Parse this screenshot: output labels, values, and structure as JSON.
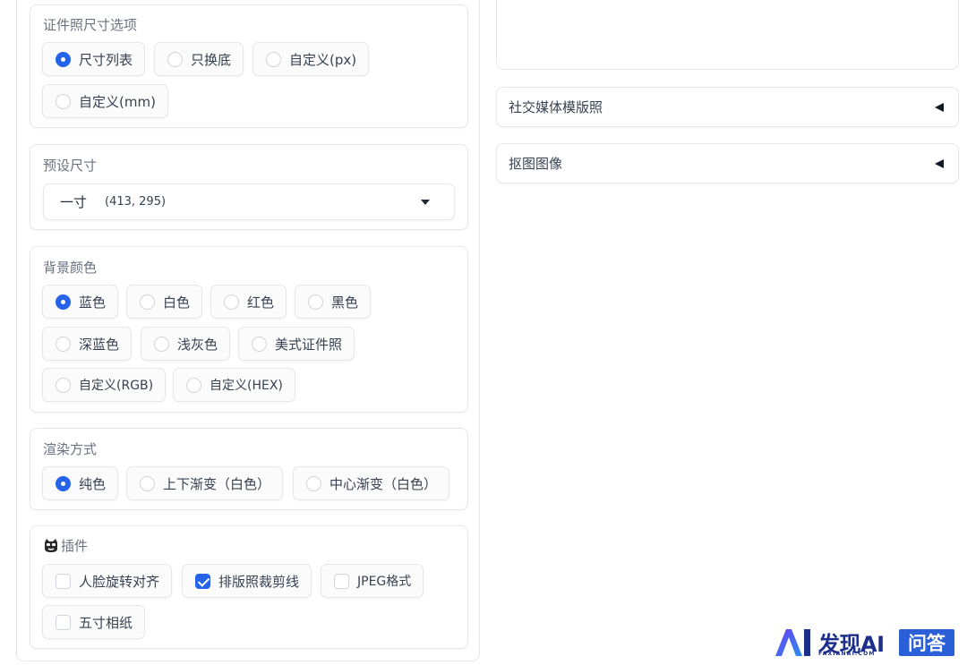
{
  "size_options": {
    "label": "证件照尺寸选项",
    "items": [
      "尺寸列表",
      "只换底",
      "自定义(px)",
      "自定义(mm)"
    ],
    "selected": "尺寸列表"
  },
  "preset_size": {
    "label": "预设尺寸",
    "value": "一寸",
    "dimensions": "(413, 295)"
  },
  "background_color": {
    "label": "背景颜色",
    "items": [
      "蓝色",
      "白色",
      "红色",
      "黑色",
      "深蓝色",
      "浅灰色",
      "美式证件照",
      "自定义(RGB)",
      "自定义(HEX)"
    ],
    "selected": "蓝色"
  },
  "render_mode": {
    "label": "渲染方式",
    "items": [
      "纯色",
      "上下渐变（白色）",
      "中心渐变（白色）"
    ],
    "selected": "纯色"
  },
  "plugins": {
    "label": "插件",
    "icon": "robot-face-icon",
    "items": [
      {
        "label": "人脸旋转对齐",
        "checked": false
      },
      {
        "label": "排版照裁剪线",
        "checked": true
      },
      {
        "label": "JPEG格式",
        "checked": false
      },
      {
        "label": "五寸相纸",
        "checked": false
      }
    ]
  },
  "accordions": {
    "social_media": "社交媒体模版照",
    "matting": "抠图图像"
  },
  "watermark": {
    "brand": "发现AI",
    "sub": "FAXIANAI.COM",
    "badge": "问答"
  },
  "colors": {
    "accent": "#2563eb",
    "border": "#e5e7eb",
    "watermark": "#1c2f8a"
  }
}
